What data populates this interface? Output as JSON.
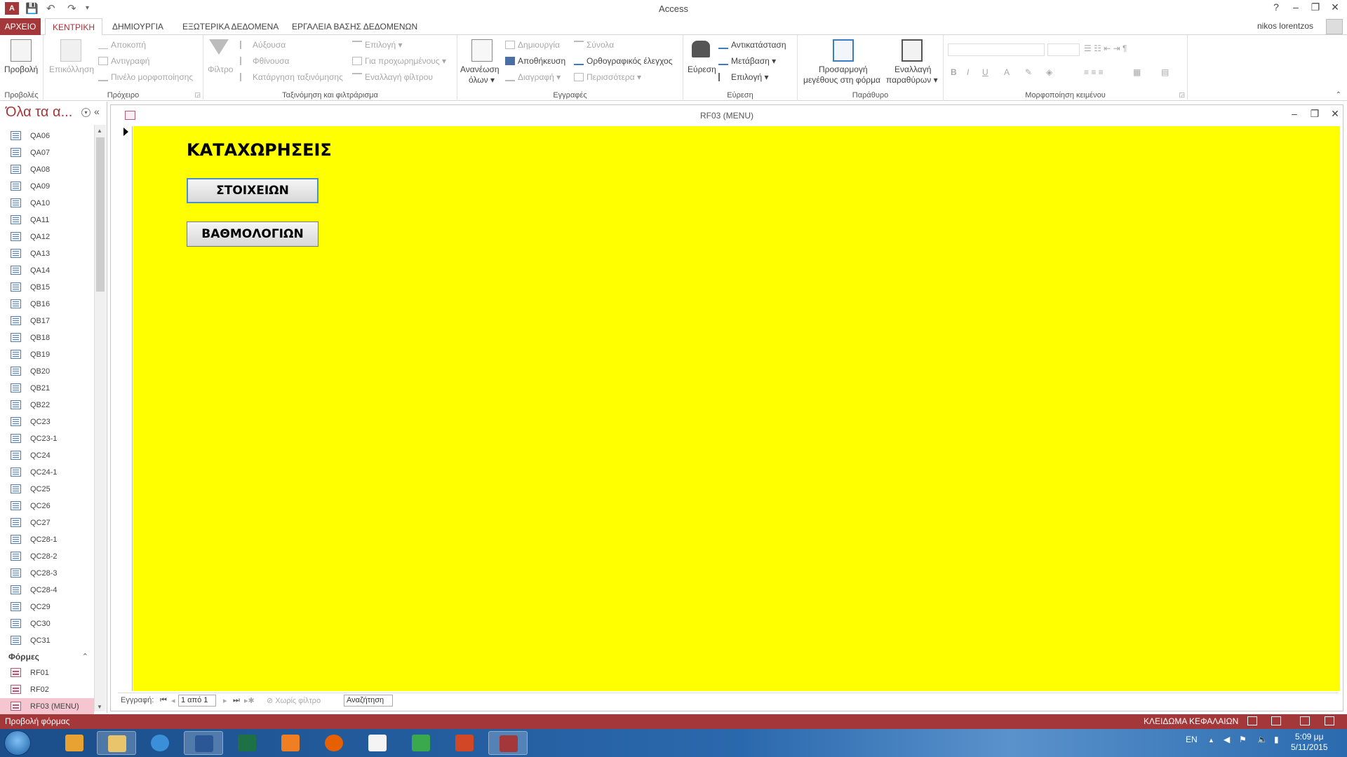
{
  "window": {
    "title": "Access",
    "help": "?",
    "minimize": "–",
    "restore": "❐",
    "close": "✕"
  },
  "tabs": [
    {
      "label": "ΑΡΧΕΙΟ"
    },
    {
      "label": "ΚΕΝΤΡΙΚΗ"
    },
    {
      "label": "ΔΗΜΙΟΥΡΓΙΑ"
    },
    {
      "label": "ΕΞΩΤΕΡΙΚΑ ΔΕΔΟΜΕΝΑ"
    },
    {
      "label": "ΕΡΓΑΛΕΙΑ ΒΑΣΗΣ ΔΕΔΟΜΕΝΩΝ"
    }
  ],
  "user": {
    "name": "nikos lorentzos"
  },
  "ribbon": {
    "views": {
      "label": "Προβολές",
      "view": "Προβολή"
    },
    "clipboard": {
      "label": "Πρόχειρο",
      "paste": "Επικόλληση",
      "cut": "Αποκοπή",
      "copy": "Αντιγραφή",
      "painter": "Πινέλο μορφοποίησης"
    },
    "sort": {
      "label": "Ταξινόμηση και φιλτράρισμα",
      "filter": "Φίλτρο",
      "asc": "Αύξουσα",
      "desc": "Φθίνουσα",
      "remove": "Κατάργηση ταξινόμησης",
      "selection": "Επιλογή",
      "advanced": "Για προχωρημένους",
      "toggle": "Εναλλαγή φίλτρου"
    },
    "records": {
      "label": "Εγγραφές",
      "refresh1": "Ανανέωση",
      "refresh2": "όλων",
      "new": "Δημιουργία",
      "save": "Αποθήκευση",
      "delete": "Διαγραφή",
      "totals": "Σύνολα",
      "spelling": "Ορθογραφικός έλεγχος",
      "more": "Περισσότερα"
    },
    "find": {
      "label": "Εύρεση",
      "find": "Εύρεση",
      "replace": "Αντικατάσταση",
      "goto": "Μετάβαση",
      "select": "Επιλογή"
    },
    "window": {
      "label": "Παράθυρο",
      "fit1": "Προσαρμογή",
      "fit2": "μεγέθους στη φόρμα",
      "switch1": "Εναλλαγή",
      "switch2": "παραθύρων"
    },
    "text": {
      "label": "Μορφοποίηση κειμένου",
      "bold": "B",
      "italic": "I",
      "underline": "U",
      "fontcolor": "A"
    }
  },
  "nav": {
    "title": "Όλα τα α...",
    "queries": [
      "QA06",
      "QA07",
      "QA08",
      "QA09",
      "QA10",
      "QA11",
      "QA12",
      "QA13",
      "QA14",
      "QB15",
      "QB16",
      "QB17",
      "QB18",
      "QB19",
      "QB20",
      "QB21",
      "QB22",
      "QC23",
      "QC23-1",
      "QC24",
      "QC24-1",
      "QC25",
      "QC26",
      "QC27",
      "QC28-1",
      "QC28-2",
      "QC28-3",
      "QC28-4",
      "QC29",
      "QC30",
      "QC31"
    ],
    "forms_section": "Φόρμες",
    "forms": [
      "RF01",
      "RF02",
      "RF03 (MENU)"
    ]
  },
  "form": {
    "title": "RF03 (MENU)",
    "heading": "ΚΑΤΑΧΩΡΗΣΕΙΣ",
    "button1": "ΣΤΟΙΧΕΙΩΝ",
    "button2": "ΒΑΘΜΟΛΟΓΙΩΝ",
    "background": "#ffff00"
  },
  "record_nav": {
    "label": "Εγγραφή:",
    "position": "1 από 1",
    "filter": "Χωρίς φίλτρο",
    "search": "Αναζήτηση"
  },
  "status": {
    "left": "Προβολή φόρμας",
    "caps": "ΚΛΕΙΔΩΜΑ ΚΕΦΑΛΑΙΩΝ"
  },
  "tray": {
    "lang": "EN",
    "time": "5:09 μμ",
    "date": "5/11/2015"
  },
  "colors": {
    "accent": "#a4373a",
    "taskbar": "#2a68ad"
  }
}
